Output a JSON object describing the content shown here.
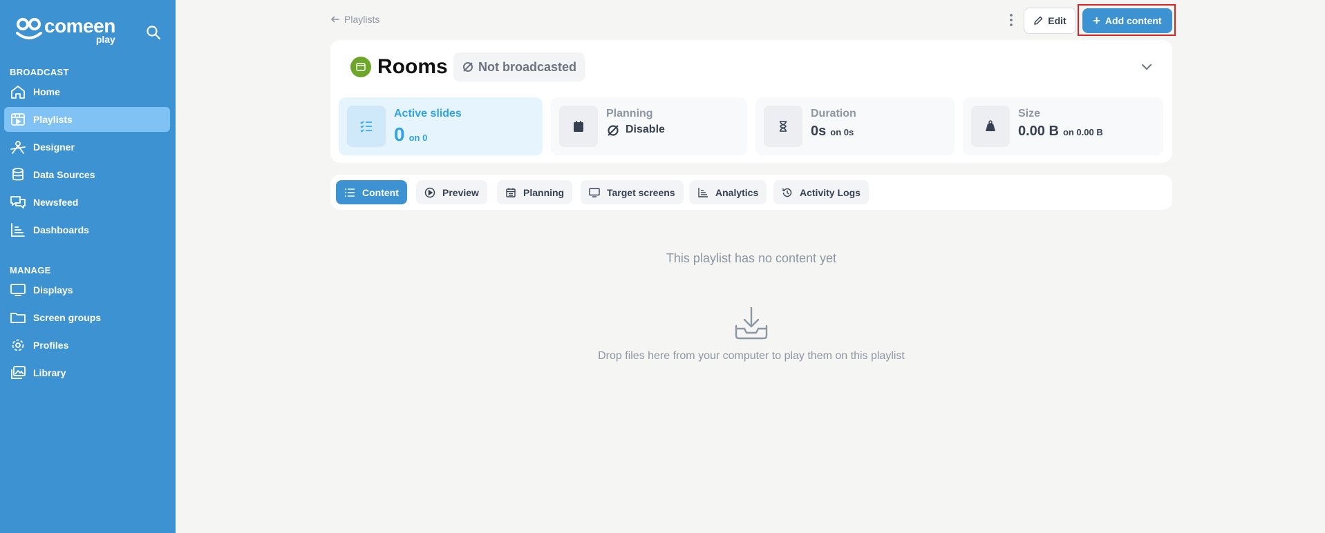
{
  "sidebar": {
    "logo_word": "comeen",
    "logo_sub": "play",
    "broadcast_label": "BROADCAST",
    "manage_label": "MANAGE",
    "broadcast_items": [
      {
        "label": "Home",
        "icon": "home-icon"
      },
      {
        "label": "Playlists",
        "icon": "playlist-icon",
        "active": true
      },
      {
        "label": "Designer",
        "icon": "designer-icon"
      },
      {
        "label": "Data Sources",
        "icon": "database-icon"
      },
      {
        "label": "Newsfeed",
        "icon": "newsfeed-icon"
      },
      {
        "label": "Dashboards",
        "icon": "dashboard-icon"
      }
    ],
    "manage_items": [
      {
        "label": "Displays",
        "icon": "display-icon"
      },
      {
        "label": "Screen groups",
        "icon": "folder-icon"
      },
      {
        "label": "Profiles",
        "icon": "gear-icon"
      },
      {
        "label": "Library",
        "icon": "library-icon"
      }
    ]
  },
  "topbar": {
    "back_label": "Playlists",
    "edit_label": "Edit",
    "add_label": "Add content"
  },
  "playlist": {
    "title": "Rooms",
    "status": "Not broadcasted",
    "stats": {
      "active_slides": {
        "label": "Active slides",
        "value": "0",
        "sub": "on 0"
      },
      "planning": {
        "label": "Planning",
        "value": "Disable"
      },
      "duration": {
        "label": "Duration",
        "value": "0s",
        "sub": "on 0s"
      },
      "size": {
        "label": "Size",
        "value": "0.00 B",
        "sub": "on 0.00 B"
      }
    }
  },
  "tabs": [
    {
      "label": "Content",
      "icon": "list-icon",
      "active": true
    },
    {
      "label": "Preview",
      "icon": "play-circle-icon"
    },
    {
      "label": "Planning",
      "icon": "calendar-icon"
    },
    {
      "label": "Target screens",
      "icon": "monitor-icon"
    },
    {
      "label": "Analytics",
      "icon": "chart-icon"
    },
    {
      "label": "Activity Logs",
      "icon": "history-icon"
    }
  ],
  "empty": {
    "title": "This playlist has no content yet",
    "drop_text": "Drop files here from your computer to play them on this playlist"
  },
  "colors": {
    "sidebar": "#3d93d1",
    "sidebar_active": "#7fc2f3",
    "accent": "#3d93d1",
    "highlight": "#2fa3e6",
    "status_green": "#6ea62a"
  }
}
